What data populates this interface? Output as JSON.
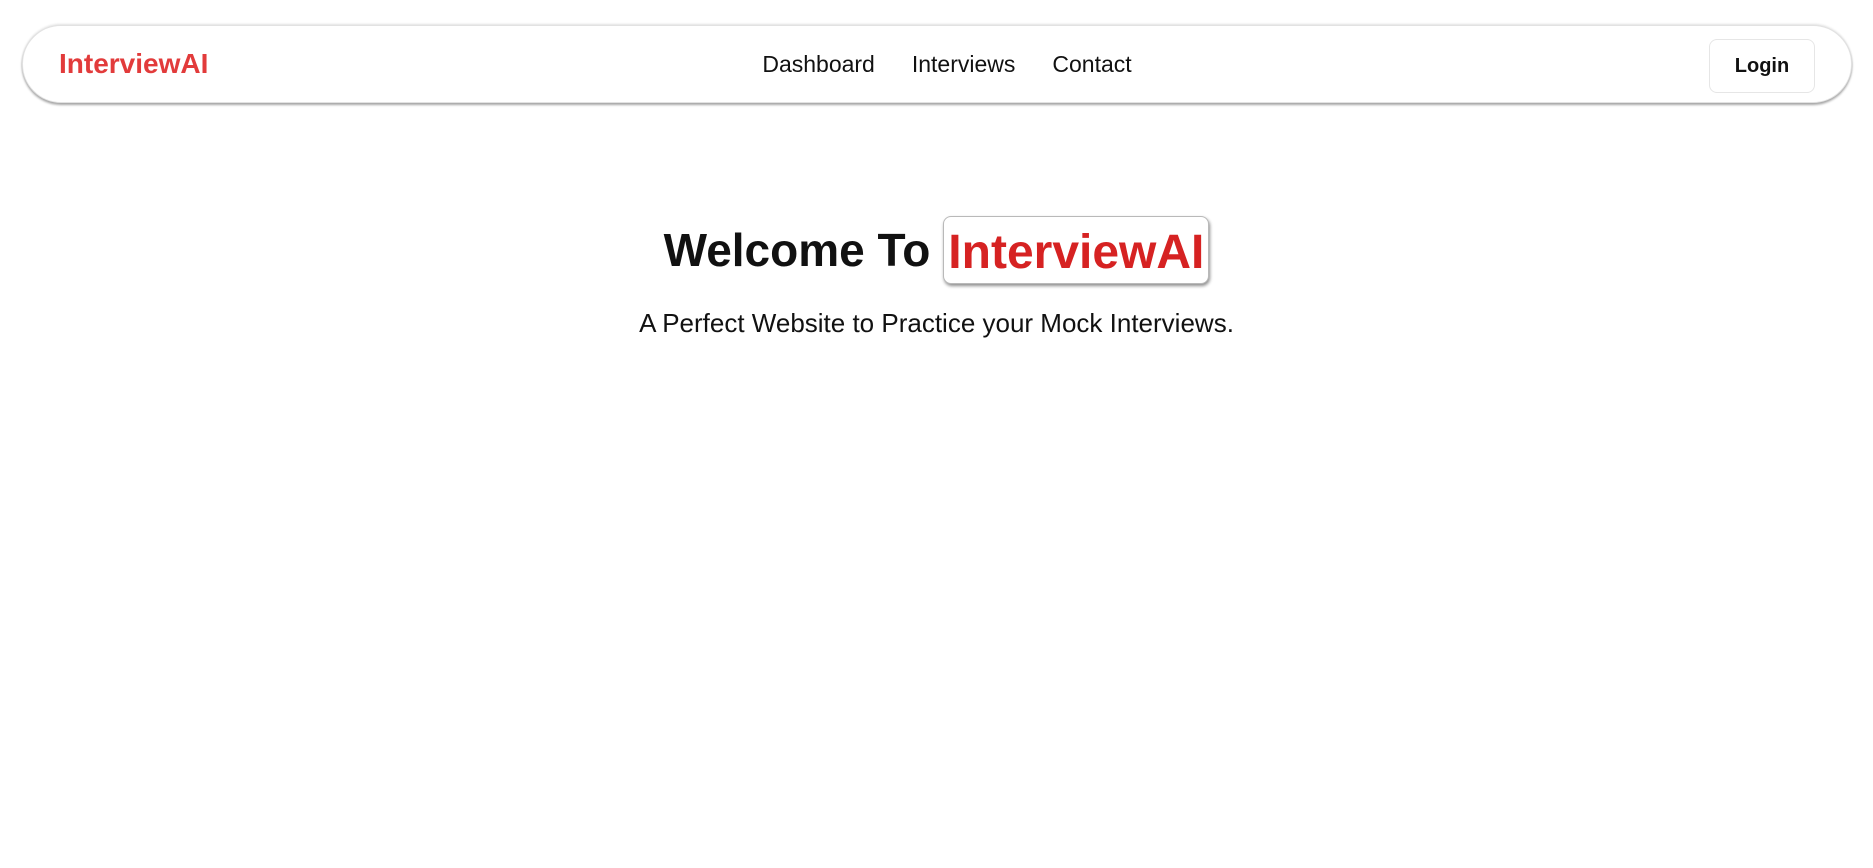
{
  "navbar": {
    "brand": "InterviewAI",
    "links": [
      {
        "label": "Dashboard"
      },
      {
        "label": "Interviews"
      },
      {
        "label": "Contact"
      }
    ],
    "login_label": "Login"
  },
  "hero": {
    "welcome_text": "Welcome To",
    "brand_text": "InterviewAI",
    "subtitle": "A Perfect Website to Practice your Mock Interviews."
  },
  "colors": {
    "brand_nav": "#e23b3b",
    "brand_hero": "#d62222",
    "text": "#111111",
    "background": "#ffffff"
  }
}
